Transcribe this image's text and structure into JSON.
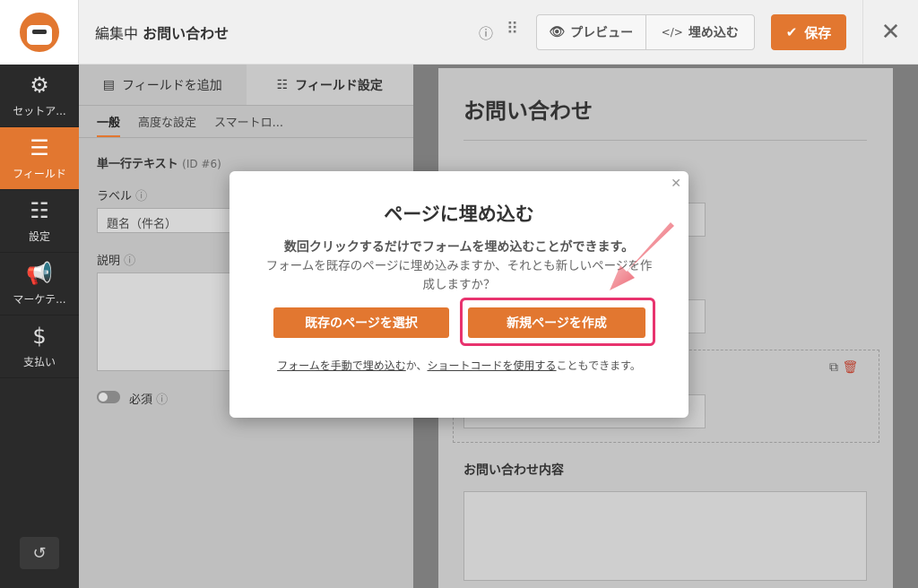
{
  "header": {
    "editing_prefix": "編集中",
    "form_name": "お問い合わせ",
    "preview_label": "プレビュー",
    "embed_label": "埋め込む",
    "save_label": "保存"
  },
  "sidebar": {
    "items": [
      {
        "label": "セットア...",
        "icon": "gear-icon"
      },
      {
        "label": "フィールド",
        "icon": "fields-icon"
      },
      {
        "label": "設定",
        "icon": "sliders-icon"
      },
      {
        "label": "マーケテ...",
        "icon": "megaphone-icon"
      },
      {
        "label": "支払い",
        "icon": "dollar-icon"
      }
    ],
    "active_index": 1
  },
  "panel": {
    "tabs": [
      "フィールドを追加",
      "フィールド設定"
    ],
    "subtabs": [
      "一般",
      "高度な設定",
      "スマートロ..."
    ],
    "field_title": "単一行テキスト",
    "field_id": "(ID #6)",
    "label_label": "ラベル",
    "label_value": "題名（件名）",
    "description_label": "説明",
    "required_label": "必須"
  },
  "preview": {
    "title": "お問い合わせ",
    "content_label": "お問い合わせ内容"
  },
  "modal": {
    "title": "ページに埋め込む",
    "desc_bold": "数回クリックするだけでフォームを埋め込むことができます。",
    "desc": "フォームを既存のページに埋め込みますか、それとも新しいページを作成しますか？",
    "select_existing": "既存のページを選択",
    "create_new": "新規ページを作成",
    "foot_link1": "フォームを手動で埋め込む",
    "foot_mid": "か、",
    "foot_link2": "ショートコードを使用する",
    "foot_end": "こともできます。"
  },
  "colors": {
    "accent": "#e27730",
    "highlight": "#e8336e"
  }
}
